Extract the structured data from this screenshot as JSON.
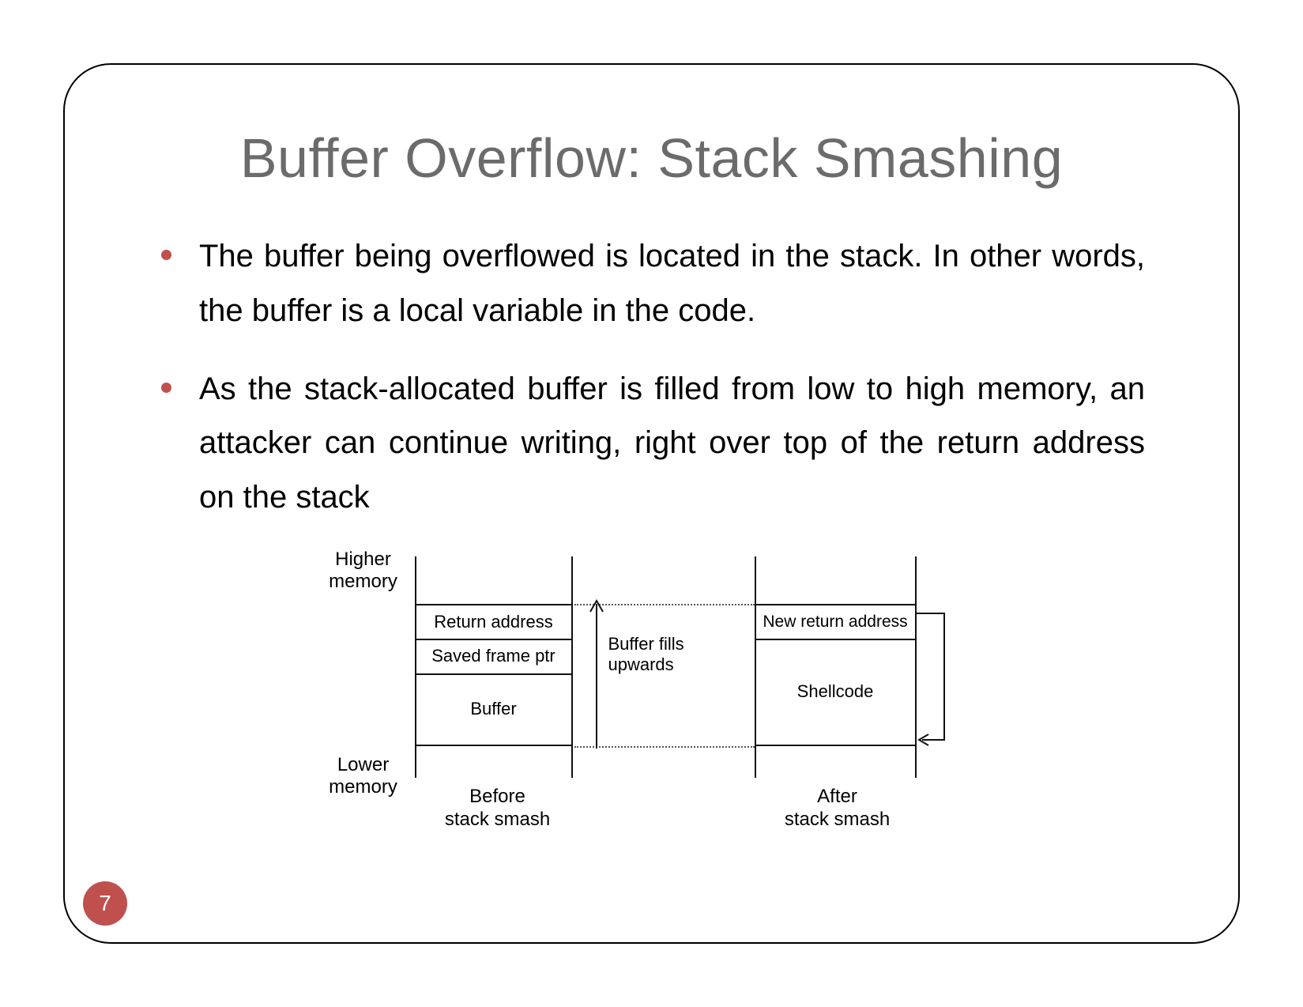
{
  "slide": {
    "title": "Buffer Overflow: Stack Smashing",
    "page_number": "7"
  },
  "bullets": [
    "The buffer being overflowed is located in the stack. In other words, the buffer is a local variable in the code.",
    "As the stack-allocated buffer is filled from low to high memory, an attacker can continue writing, right over top of the return address on the stack"
  ],
  "diagram": {
    "higher_memory_label": "Higher\nmemory",
    "lower_memory_label": "Lower\nmemory",
    "before": {
      "cells": [
        "Return address",
        "Saved frame ptr",
        "Buffer"
      ],
      "caption": "Before\nstack smash"
    },
    "arrow_label": "Buffer fills\nupwards",
    "after": {
      "cells": [
        "New return address",
        "Shellcode"
      ],
      "caption": "After\nstack smash"
    }
  }
}
